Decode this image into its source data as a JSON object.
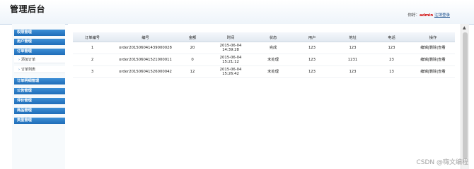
{
  "header": {
    "title": "管理后台",
    "greeting": "你好：",
    "username": "admin",
    "logout": "注销登录"
  },
  "sidebar": {
    "groups": [
      {
        "label": "权限管理"
      },
      {
        "label": "用户管理"
      },
      {
        "label": "订单管理"
      },
      {
        "label": "订单明细管理"
      },
      {
        "label": "公告管理"
      },
      {
        "label": "评价管理"
      },
      {
        "label": "商品管理"
      },
      {
        "label": "类型管理"
      }
    ],
    "subitems": [
      {
        "label": "添加订单"
      },
      {
        "label": "订单列表"
      }
    ]
  },
  "table": {
    "columns": [
      "订单编号",
      "编号",
      "金额",
      "时间",
      "状态",
      "用户",
      "地址",
      "电话",
      "操作"
    ],
    "rows": [
      {
        "id": "1",
        "code": "order2015060414390000​28",
        "amount": "20",
        "date": "2015-06-04",
        "time": "14:39:28",
        "status": "完成",
        "user": "123",
        "address": "123",
        "phone": "123"
      },
      {
        "id": "2",
        "code": "order201506041521000011",
        "amount": "0",
        "date": "2015-06-04",
        "time": "15:21:12",
        "status": "未处理",
        "user": "123",
        "address": "1231",
        "phone": "23"
      },
      {
        "id": "3",
        "code": "order201506041526000042",
        "amount": "12",
        "date": "2015-06-04",
        "time": "15:26:42",
        "status": "未处理",
        "user": "123",
        "address": "123",
        "phone": "13"
      }
    ],
    "ops": {
      "edit": "编辑",
      "delete": "删除",
      "view": "查看",
      "sep": "|"
    }
  },
  "watermark": "CSDN @嗨文编程"
}
